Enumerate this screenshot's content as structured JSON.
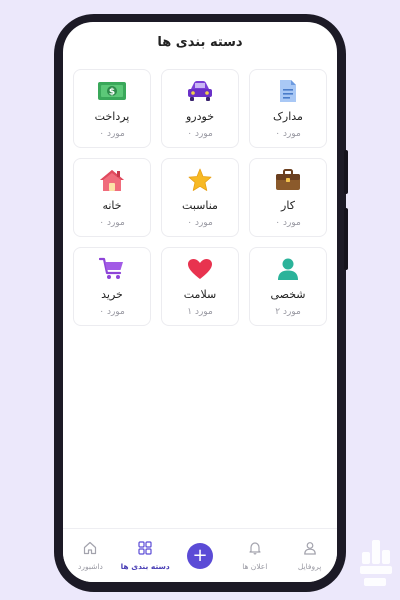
{
  "header": {
    "title": "دسته بندی ها"
  },
  "categories": [
    {
      "name": "پرداخت",
      "count": "۰ مورد",
      "icon": "money-icon"
    },
    {
      "name": "خودرو",
      "count": "۰ مورد",
      "icon": "car-icon"
    },
    {
      "name": "مدارک",
      "count": "۰ مورد",
      "icon": "document-icon"
    },
    {
      "name": "خانه",
      "count": "۰ مورد",
      "icon": "house-icon"
    },
    {
      "name": "مناسبت",
      "count": "۰ مورد",
      "icon": "star-icon"
    },
    {
      "name": "کار",
      "count": "۰ مورد",
      "icon": "briefcase-icon"
    },
    {
      "name": "خرید",
      "count": "۰ مورد",
      "icon": "shopping-cart-icon"
    },
    {
      "name": "سلامت",
      "count": "۱ مورد",
      "icon": "heart-icon"
    },
    {
      "name": "شخصی",
      "count": "۲ مورد",
      "icon": "person-icon"
    }
  ],
  "nav": {
    "dashboard": "داشبورد",
    "categories": "دسته بندی ها",
    "add": "+",
    "notifications": "اعلان ها",
    "profile": "پروفایل"
  },
  "colors": {
    "accent": "#5b4bd6",
    "active_label": "#4a3fb5",
    "background": "#ece8fb"
  }
}
